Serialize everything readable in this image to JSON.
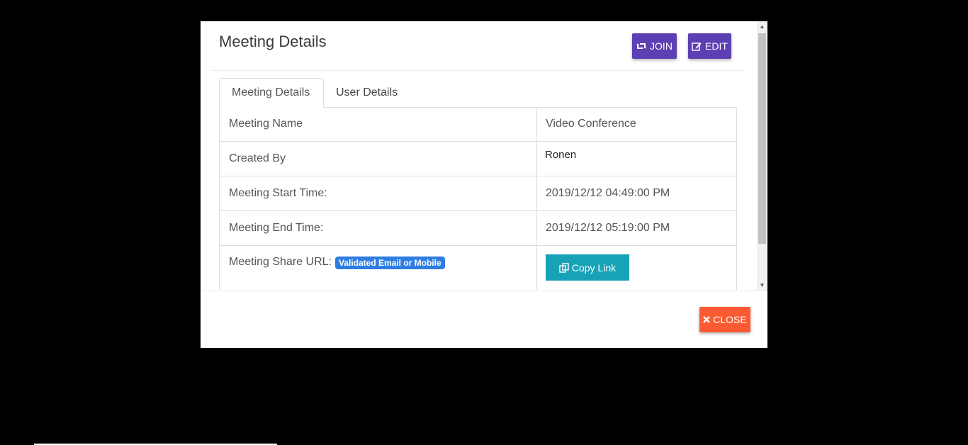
{
  "modal": {
    "title": "Meeting Details",
    "join_label": "JOIN",
    "edit_label": "EDIT",
    "close_label": "CLOSE"
  },
  "tabs": [
    {
      "label": "Meeting Details",
      "active": true
    },
    {
      "label": "User Details",
      "active": false
    }
  ],
  "details": {
    "meeting_name_label": "Meeting Name",
    "meeting_name_value": "Video Conference",
    "created_by_label": "Created By",
    "created_by_value": "Ronen",
    "start_label": "Meeting Start Time:",
    "start_value": "2019/12/12 04:49:00 PM",
    "end_label": "Meeting End Time:",
    "end_value": "2019/12/12 05:19:00 PM",
    "share_label": "Meeting Share URL:",
    "share_badge": "Validated Email or Mobile",
    "copy_label": "Copy Link"
  },
  "colors": {
    "primary": "#5b3fb3",
    "info": "#17a2b8",
    "danger": "#fb5a33",
    "badge": "#2f7de1"
  }
}
